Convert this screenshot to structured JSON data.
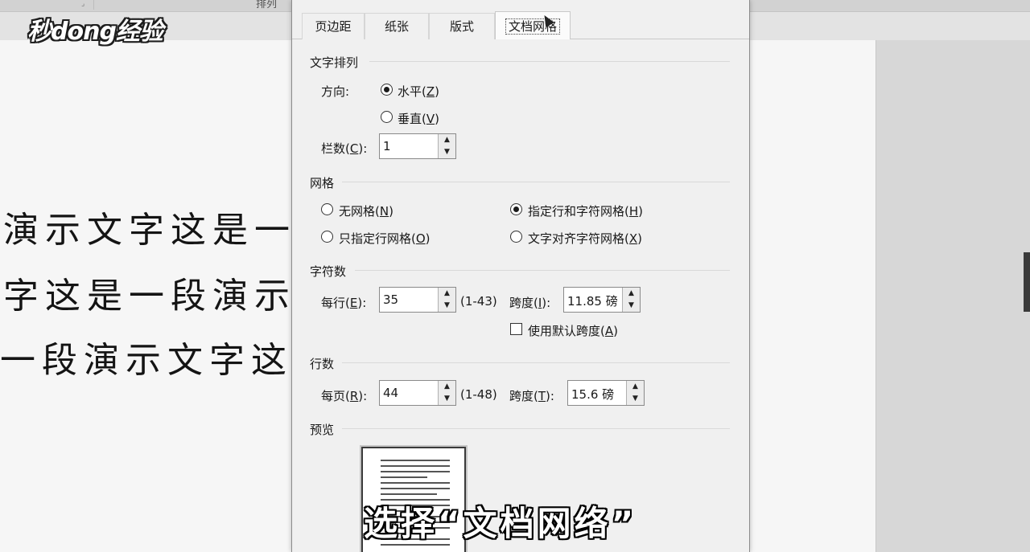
{
  "ribbon": {
    "partial_group_label": "排列",
    "launcher_icon": "dialog-launcher-icon"
  },
  "watermark": {
    "logo_text": "秒dong经验"
  },
  "document": {
    "lines": [
      "演示文字这是一",
      "字这是一段演示",
      "一段演示文字这"
    ]
  },
  "dialog": {
    "tabs": [
      {
        "label": "页边距",
        "active": false
      },
      {
        "label": "纸张",
        "active": false
      },
      {
        "label": "版式",
        "active": false
      },
      {
        "label": "文档网格",
        "active": true
      }
    ],
    "text_direction": {
      "title": "文字排列",
      "direction_label": "方向:",
      "horizontal_label": "水平(",
      "horizontal_key": "Z",
      "vertical_label": "垂直(",
      "vertical_key": "V",
      "selected": "horizontal",
      "columns_label": "栏数(",
      "columns_key": "C",
      "columns_value": "1"
    },
    "grid": {
      "title": "网格",
      "options": [
        {
          "label": "无网格(",
          "key": "N",
          "checked": false
        },
        {
          "label": "指定行和字符网格(",
          "key": "H",
          "checked": true
        },
        {
          "label": "只指定行网格(",
          "key": "O",
          "checked": false
        },
        {
          "label": "文字对齐字符网格(",
          "key": "X",
          "checked": false
        }
      ]
    },
    "characters": {
      "title": "字符数",
      "per_line_label": "每行(",
      "per_line_key": "E",
      "per_line_value": "35",
      "per_line_range": "(1-43)",
      "pitch_label": "跨度(",
      "pitch_key": "I",
      "pitch_value": "11.85 磅",
      "default_pitch_label": "使用默认跨度(",
      "default_pitch_key": "A",
      "default_pitch_checked": false
    },
    "lines": {
      "title": "行数",
      "per_page_label": "每页(",
      "per_page_key": "R",
      "per_page_value": "44",
      "per_page_range": "(1-48)",
      "pitch_label": "跨度(",
      "pitch_key": "T",
      "pitch_value": "15.6 磅"
    },
    "preview": {
      "title": "预览"
    }
  },
  "subtitle": "选择“文档网络”"
}
